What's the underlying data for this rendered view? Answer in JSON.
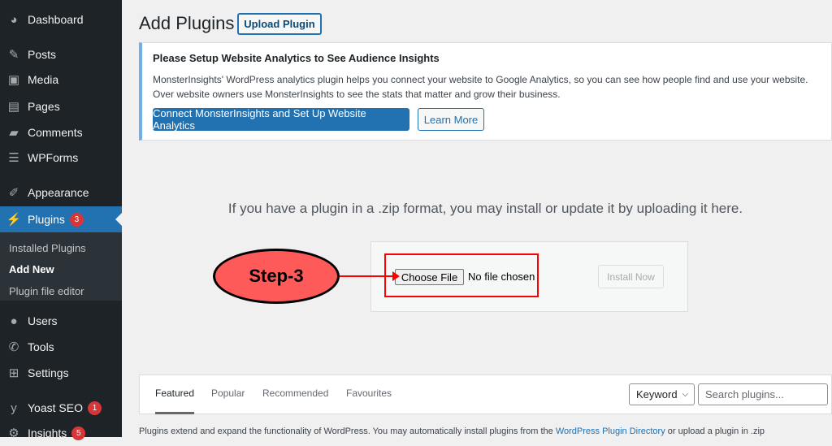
{
  "sidebar": {
    "items": [
      {
        "label": "Dashboard",
        "icon": "dashboard-icon",
        "glyph": "◕"
      },
      {
        "label": "Posts",
        "icon": "pin-icon",
        "glyph": "✎"
      },
      {
        "label": "Media",
        "icon": "media-icon",
        "glyph": "▣"
      },
      {
        "label": "Pages",
        "icon": "pages-icon",
        "glyph": "▤"
      },
      {
        "label": "Comments",
        "icon": "comment-icon",
        "glyph": "▰"
      },
      {
        "label": "WPForms",
        "icon": "forms-icon",
        "glyph": "☰"
      },
      {
        "label": "Appearance",
        "icon": "brush-icon",
        "glyph": "✐"
      },
      {
        "label": "Plugins",
        "icon": "plug-icon",
        "glyph": "⚡",
        "badge": "3"
      },
      {
        "label": "Users",
        "icon": "user-icon",
        "glyph": "●"
      },
      {
        "label": "Tools",
        "icon": "wrench-icon",
        "glyph": "✆"
      },
      {
        "label": "Settings",
        "icon": "settings-icon",
        "glyph": "⊞"
      },
      {
        "label": "Yoast SEO",
        "icon": "yoast-icon",
        "glyph": "y",
        "badge": "1"
      },
      {
        "label": "Insights",
        "icon": "insights-icon",
        "glyph": "⚙",
        "badge": "5"
      }
    ],
    "submenu": [
      "Installed Plugins",
      "Add New",
      "Plugin file editor"
    ]
  },
  "header": {
    "title": "Add Plugins",
    "upload_label": "Upload Plugin"
  },
  "notice": {
    "title": "Please Setup Website Analytics to See Audience Insights",
    "line1": "MonsterInsights' WordPress analytics plugin helps you connect your website to Google Analytics, so you can see how people find and use your website. Over",
    "line2": "website owners use MonsterInsights to see the stats that matter and grow their business.",
    "connect_label": "Connect MonsterInsights and Set Up Website Analytics",
    "learn_label": "Learn More"
  },
  "upload": {
    "text": "If you have a plugin in a .zip format, you may install or update it by uploading it here.",
    "choose_label": "Choose File",
    "no_file": "No file chosen",
    "install_label": "Install Now"
  },
  "annotation": {
    "label": "Step-3",
    "color": "#ff5a5a"
  },
  "filter": {
    "tabs": [
      "Featured",
      "Popular",
      "Recommended",
      "Favourites"
    ],
    "keyword": "Keyword",
    "search_placeholder": "Search plugins..."
  },
  "footer": {
    "pre": "Plugins extend and expand the functionality of WordPress. You may automatically install plugins from the ",
    "link": "WordPress Plugin Directory",
    "post": " or upload a plugin in .zip"
  }
}
